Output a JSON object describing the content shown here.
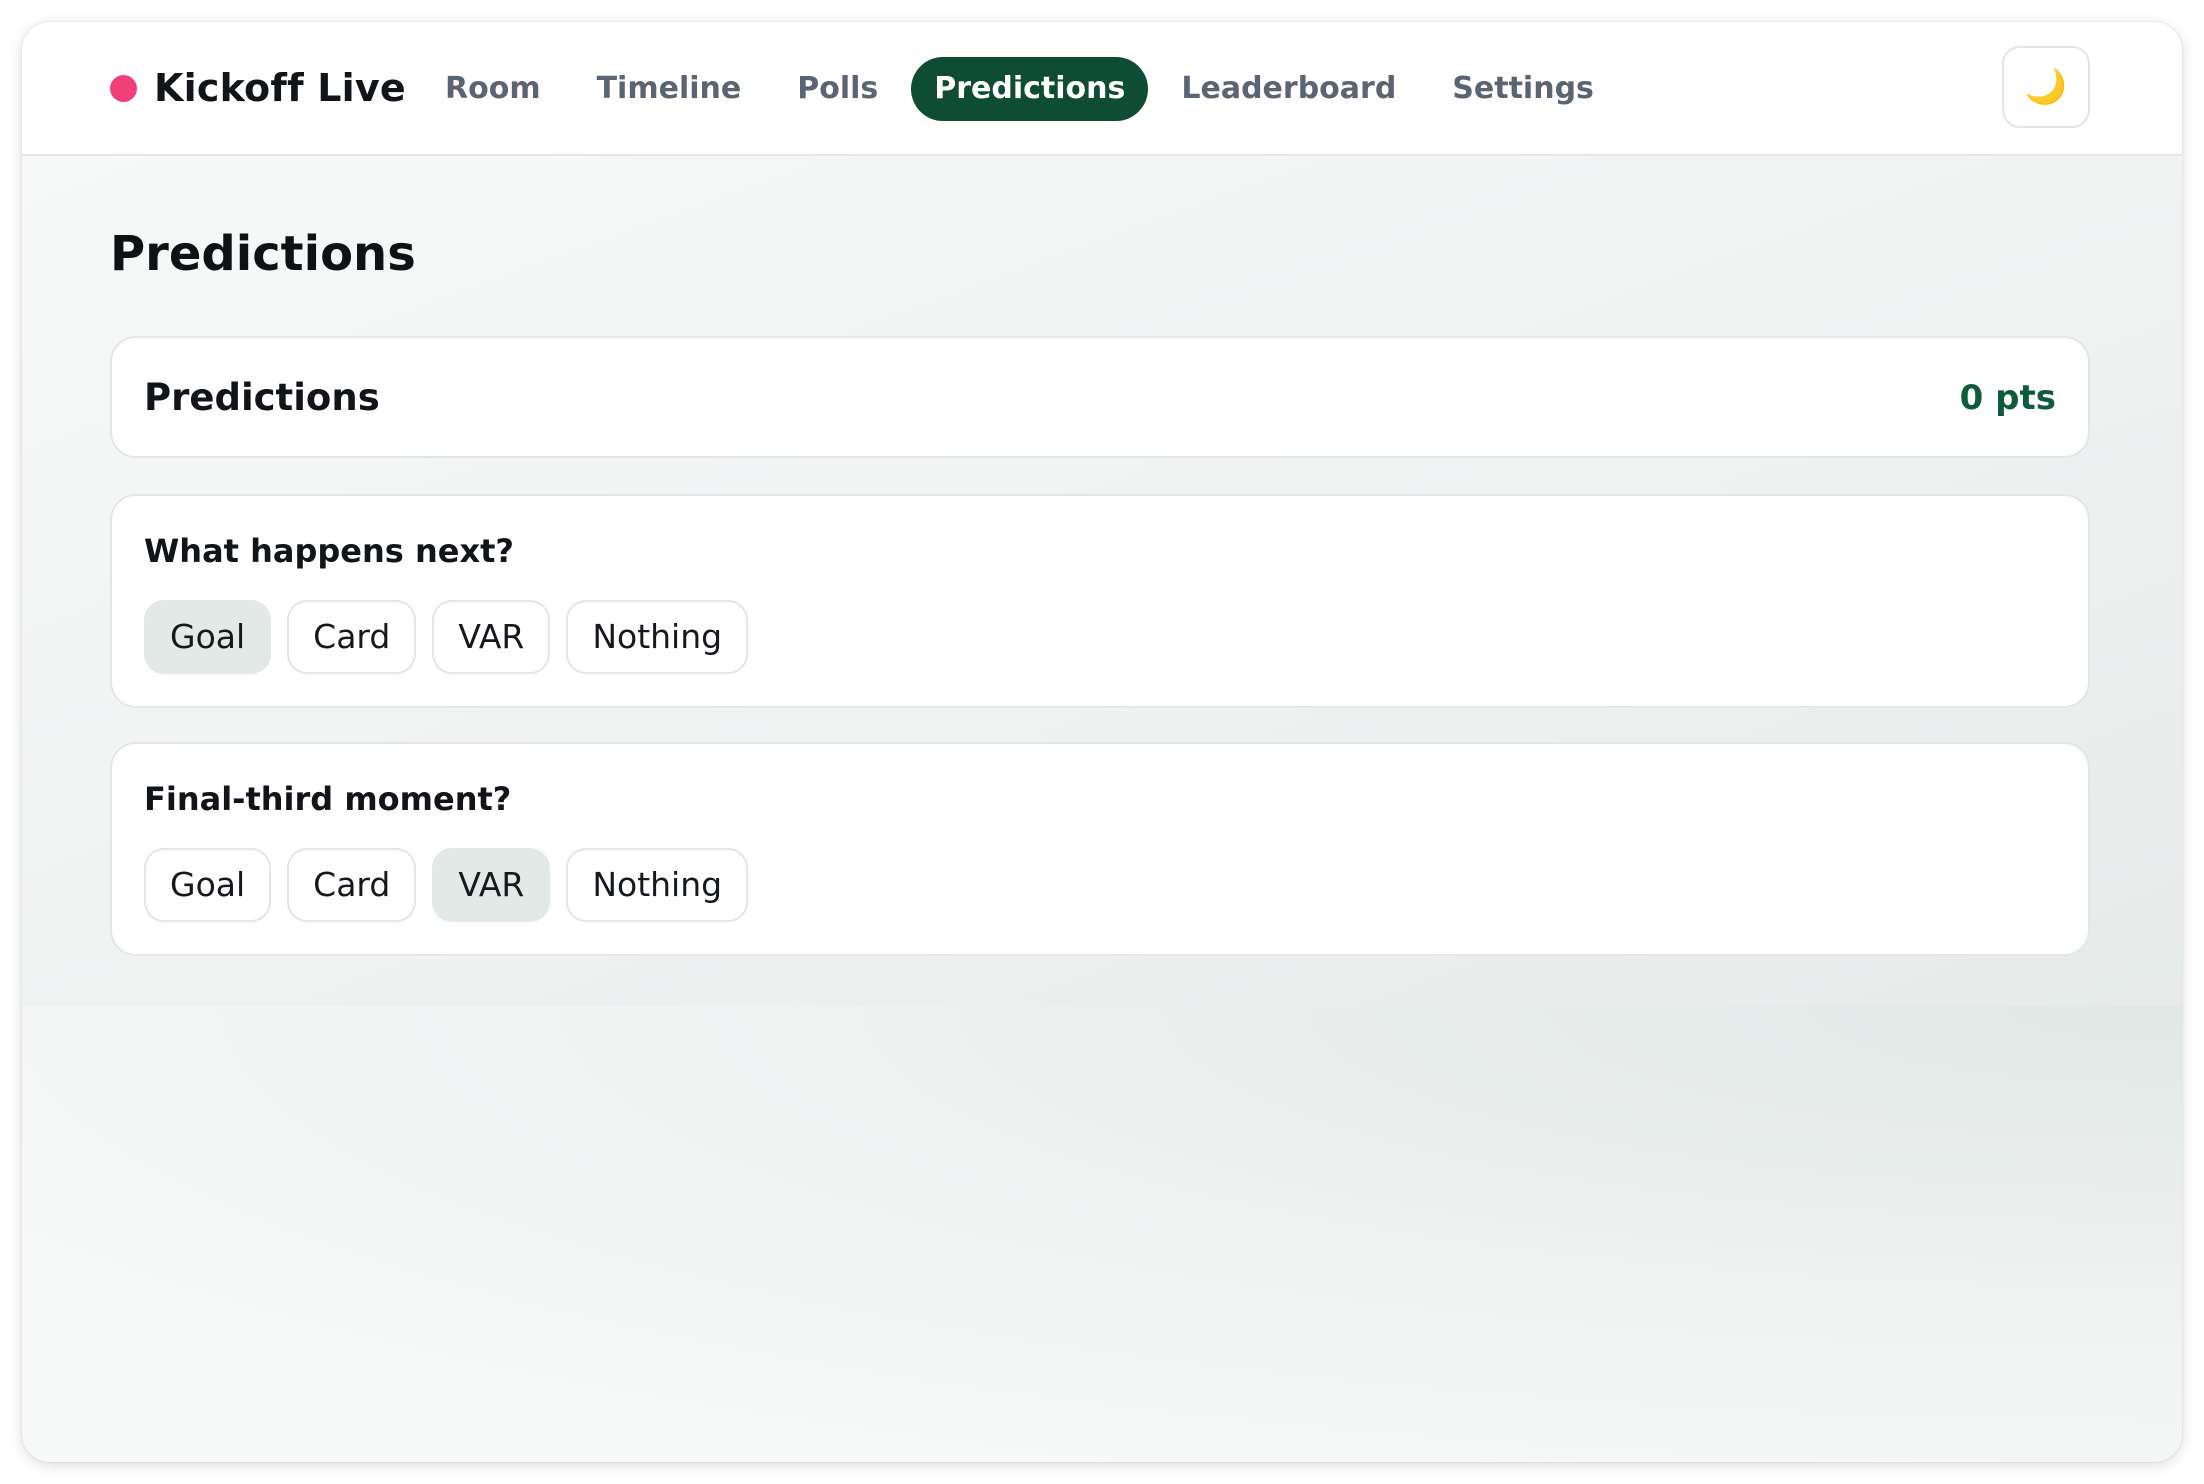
{
  "app": {
    "name": "Kickoff Live",
    "live_color": "#f23f79",
    "accent": "#0e4d33"
  },
  "nav": {
    "tabs": [
      {
        "label": "Room",
        "active": false
      },
      {
        "label": "Timeline",
        "active": false
      },
      {
        "label": "Polls",
        "active": false
      },
      {
        "label": "Predictions",
        "active": true
      },
      {
        "label": "Leaderboard",
        "active": false
      },
      {
        "label": "Settings",
        "active": false
      }
    ],
    "theme_toggle_icon": "moon-icon",
    "theme_toggle_glyph": "🌙"
  },
  "page": {
    "title": "Predictions"
  },
  "summary": {
    "title": "Predictions",
    "points": "0 pts"
  },
  "questions": [
    {
      "title": "What happens next?",
      "options": [
        "Goal",
        "Card",
        "VAR",
        "Nothing"
      ],
      "selected": "Goal"
    },
    {
      "title": "Final-third moment?",
      "options": [
        "Goal",
        "Card",
        "VAR",
        "Nothing"
      ],
      "selected": "VAR"
    }
  ]
}
